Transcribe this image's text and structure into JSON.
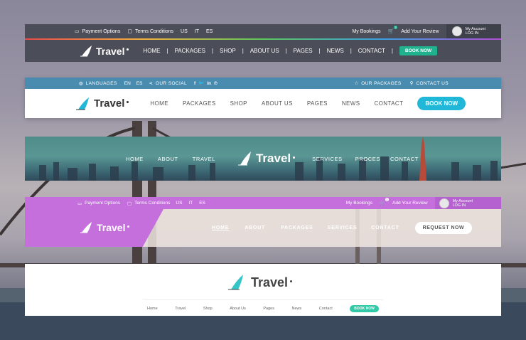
{
  "colors": {
    "accent_green": "#20b28e",
    "accent_cyan": "#20b7d9",
    "accent_purple": "#c46fdc",
    "dark_bar": "#4b4e58",
    "blue_bar": "#4a8caf"
  },
  "header1": {
    "top": {
      "payment": "Payment Options",
      "terms": "Terms Conditions",
      "langs": [
        "US",
        "IT",
        "ES"
      ],
      "bookings": "My Bookings",
      "cart_count": "3",
      "review": "Add Your Review",
      "account": "My Account",
      "login": "LOG IN"
    },
    "logo": "Travel",
    "nav": [
      "HOME",
      "PACKAGES",
      "SHOP",
      "ABOUT US",
      "PAGES",
      "NEWS",
      "CONTACT"
    ],
    "cta": "BOOK NOW"
  },
  "header2": {
    "top": {
      "languages": "LANGUAGES",
      "langs": [
        "EN",
        "ES"
      ],
      "social": "OUR SOCIAL",
      "packages": "OUR PACKAGES",
      "contact": "CONTACT US"
    },
    "logo": "Travel",
    "nav": [
      "HOME",
      "PACKAGES",
      "SHOP",
      "ABOUT US",
      "PAGES",
      "NEWS",
      "CONTACT"
    ],
    "cta": "BOOK NOW"
  },
  "header3": {
    "nav_left": [
      "HOME",
      "ABOUT",
      "TRAVEL"
    ],
    "logo": "Travel",
    "nav_right": [
      "SERVICES",
      "PROCES",
      "CONTACT"
    ]
  },
  "header4": {
    "top": {
      "payment": "Payment Options",
      "terms": "Terms Conditions",
      "langs": [
        "US",
        "IT",
        "ES"
      ],
      "bookings": "My Bookings",
      "cart_count": "3",
      "review": "Add Your Review",
      "account": "My Account",
      "login": "LOG IN"
    },
    "logo": "Travel",
    "nav": [
      "HOME",
      "ABOUT",
      "PACKAGES",
      "SERVICES",
      "CONTACT"
    ],
    "cta": "REQUEST NOW"
  },
  "header5": {
    "logo": "Travel",
    "nav": [
      "Home",
      "Travel",
      "Shop",
      "About Us",
      "Pages",
      "News",
      "Contact"
    ],
    "cta": "BOOK NOW"
  }
}
